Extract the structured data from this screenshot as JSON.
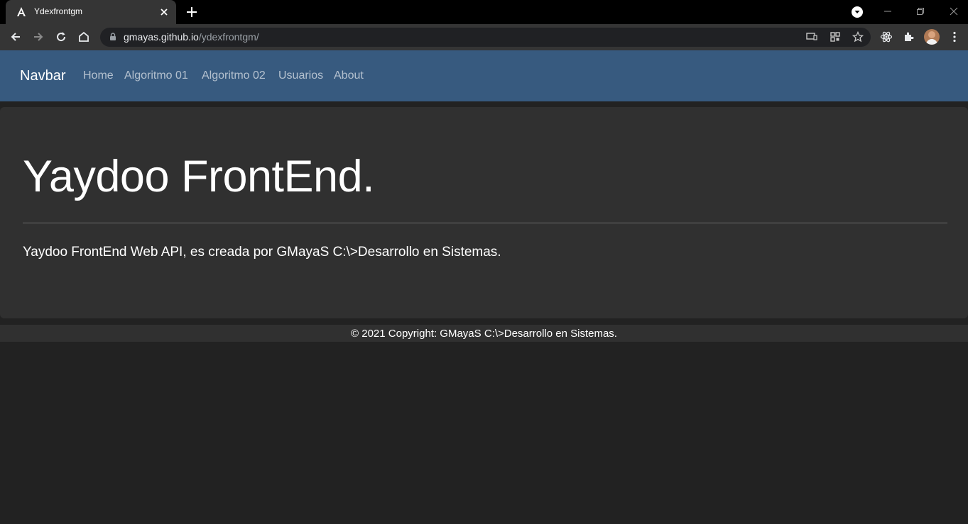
{
  "browser": {
    "tab_title": "Ydexfrontgm",
    "url_host": "gmayas.github.io",
    "url_path": "/ydexfrontgm/"
  },
  "navbar": {
    "brand": "Navbar",
    "links": [
      {
        "label": "Home"
      },
      {
        "label": "Algoritmo 01"
      },
      {
        "label": "Algoritmo 02"
      },
      {
        "label": "Usuarios"
      },
      {
        "label": "About"
      }
    ]
  },
  "jumbotron": {
    "title": "Yaydoo FrontEnd.",
    "lead": "Yaydoo FrontEnd Web API, es creada por GMayaS C:\\>Desarrollo en Sistemas."
  },
  "footer": {
    "text": "© 2021 Copyright: GMayaS C:\\>Desarrollo en Sistemas."
  },
  "colors": {
    "navbar_bg": "#375a7f",
    "page_bg": "#222222",
    "jumbotron_bg": "#303030"
  }
}
